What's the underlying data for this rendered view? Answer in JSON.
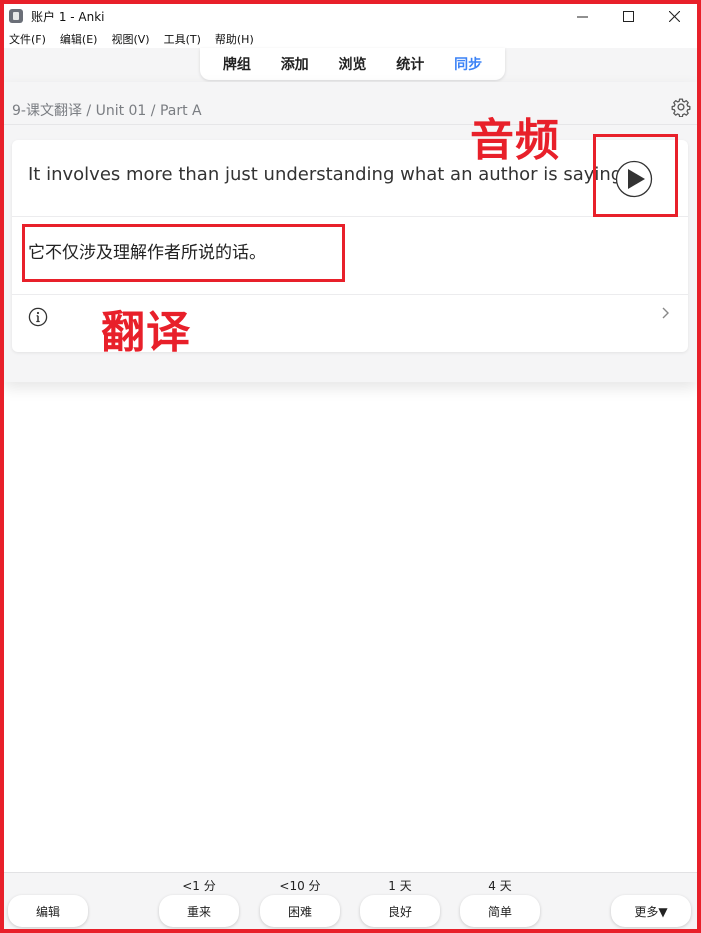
{
  "window": {
    "title": "账户 1 - Anki"
  },
  "menu": {
    "items": [
      "文件(F)",
      "编辑(E)",
      "视图(V)",
      "工具(T)",
      "帮助(H)"
    ]
  },
  "toolbar": {
    "items": [
      {
        "label": "牌组",
        "active": false
      },
      {
        "label": "添加",
        "active": false
      },
      {
        "label": "浏览",
        "active": false
      },
      {
        "label": "统计",
        "active": false
      },
      {
        "label": "同步",
        "active": true
      }
    ]
  },
  "deck": {
    "breadcrumb": "9-课文翻译 / Unit 01 / Part A"
  },
  "card": {
    "front": "It involves more than just understanding what an author is saying.",
    "back": "它不仅涉及理解作者所说的话。"
  },
  "annotations": {
    "audio_label": "音频",
    "translation_label": "翻译",
    "color": "#e8202a"
  },
  "bottom": {
    "edit_label": "编辑",
    "more_label": "更多▼",
    "answers": [
      {
        "label": "重来",
        "interval": "<1 分"
      },
      {
        "label": "困难",
        "interval": "<10 分"
      },
      {
        "label": "良好",
        "interval": "1 天"
      },
      {
        "label": "简单",
        "interval": "4 天"
      }
    ]
  },
  "colors": {
    "accent": "#3b82f6",
    "annotation": "#e8202a"
  }
}
